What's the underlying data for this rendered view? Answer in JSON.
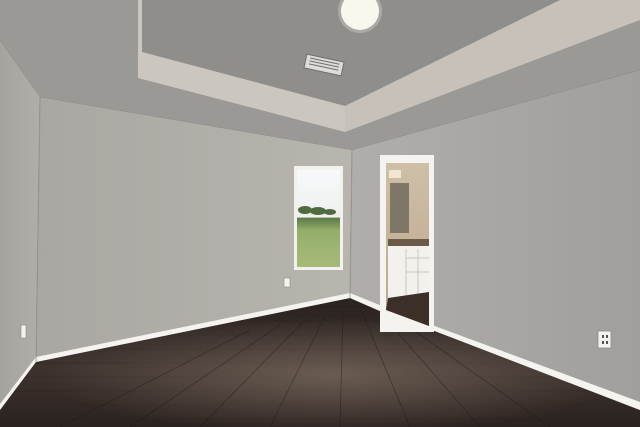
{
  "scene": {
    "subject": "empty room",
    "colors": {
      "wall_left": "#a9a6a1",
      "wall_back": "#b3b0aa",
      "wall_right": "#a8a6a2",
      "ceiling": "#9a9996",
      "tray_ceiling": "#c8c3bc",
      "trim": "#f4f3f0",
      "floor": "#3a302b",
      "floor_highlight": "#6b5b50",
      "window_sky": "#f2f4f4",
      "window_grass": "#8ea86a",
      "bathroom": "#d8c9b4",
      "vanity": "#f2f1ee",
      "countertop": "#6b5a47"
    }
  }
}
